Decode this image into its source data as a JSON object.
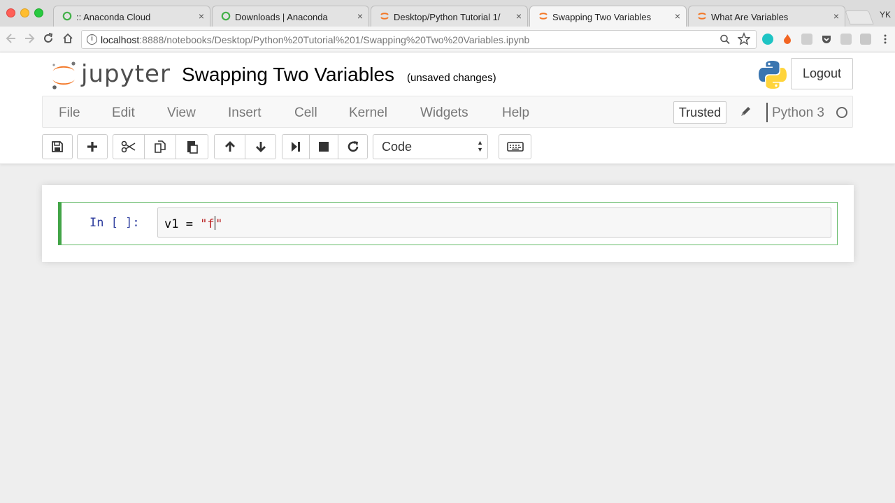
{
  "browser": {
    "tabs": [
      {
        "title": ":: Anaconda Cloud",
        "favicon": "anaconda-icon",
        "active": false
      },
      {
        "title": "Downloads | Anaconda",
        "favicon": "anaconda-icon",
        "active": false
      },
      {
        "title": "Desktop/Python Tutorial 1/",
        "favicon": "jupyter-icon",
        "active": false
      },
      {
        "title": "Swapping Two Variables",
        "favicon": "jupyter-icon",
        "active": true
      },
      {
        "title": "What Are Variables",
        "favicon": "jupyter-icon",
        "active": false
      }
    ],
    "close_glyph": "×",
    "profile": "YK",
    "url_host": "localhost",
    "url_rest": ":8888/notebooks/Desktop/Python%20Tutorial%201/Swapping%20Two%20Variables.ipynb"
  },
  "header": {
    "logo_text": "jupyter",
    "notebook_title": "Swapping Two Variables",
    "save_status": "(unsaved changes)",
    "logout_label": "Logout"
  },
  "menu": {
    "items": [
      "File",
      "Edit",
      "View",
      "Insert",
      "Cell",
      "Kernel",
      "Widgets",
      "Help"
    ],
    "trusted_label": "Trusted",
    "kernel_name": "Python 3"
  },
  "toolbar": {
    "cell_type": "Code",
    "buttons": [
      "save-icon",
      "plus-icon",
      "cut-icon",
      "copy-icon",
      "paste-icon",
      "arrow-up-icon",
      "arrow-down-icon",
      "step-forward-icon",
      "stop-icon",
      "refresh-icon",
      "keyboard-icon"
    ]
  },
  "cell": {
    "prompt": "In [ ]:",
    "code_prefix": "v1 = ",
    "code_string_open": "\"f",
    "code_string_close": "\""
  },
  "colors": {
    "jupyter_orange": "#f37726",
    "cell_selected_border": "#42a447",
    "prompt_blue": "#303f9f",
    "string_red": "#ba2121"
  }
}
